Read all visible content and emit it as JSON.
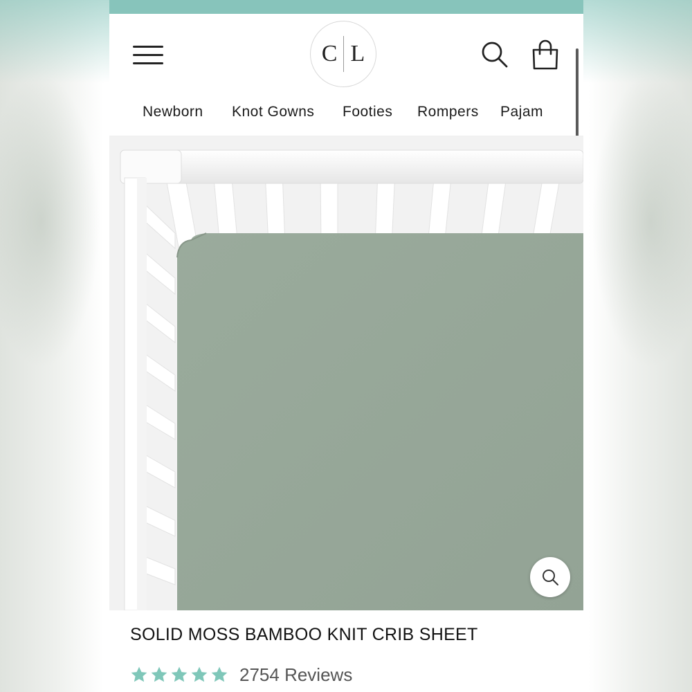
{
  "colors": {
    "accent_teal": "#87c4bb",
    "star": "#7fc7b9",
    "sheet": "#97a899",
    "crib": "#ffffff"
  },
  "header": {
    "logo_left": "C",
    "logo_right": "L",
    "icons": [
      "menu-icon",
      "search-icon",
      "bag-icon"
    ]
  },
  "nav": {
    "items": [
      "Newborn",
      "Knot Gowns",
      "Footies",
      "Rompers",
      "Pajam"
    ]
  },
  "product": {
    "title": "SOLID MOSS BAMBOO KNIT CRIB SHEET",
    "rating": 5,
    "reviews_label": "2754 Reviews",
    "image_icon": "zoom-icon"
  }
}
